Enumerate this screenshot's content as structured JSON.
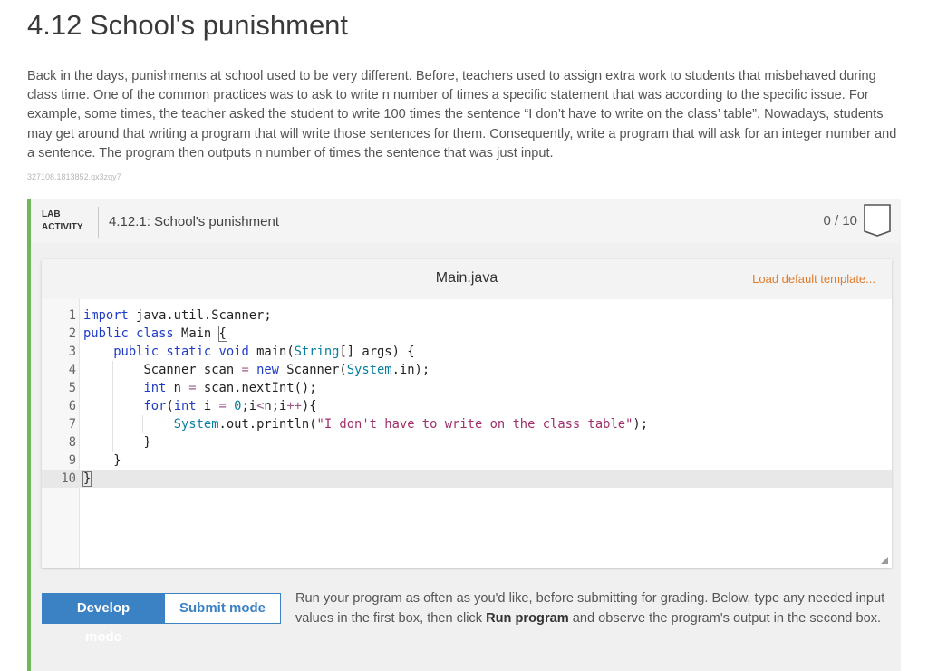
{
  "page": {
    "title": "4.12 School's punishment",
    "description": "Back in the days, punishments at school used to be very different. Before, teachers used to assign extra work to students that misbehaved during class time. One of the common practices was to ask to write n number of times a specific statement that was according to the specific issue. For example, some times, the teacher asked the student to write 100 times the sentence “I don’t have to write on the class’ table”. Nowadays, students may get around that writing a program that will write those sentences for them. Consequently, write a program that will ask for an integer number and a sentence. The program then outputs n number of times the sentence that was just input.",
    "hash": "327108.1813852.qx3zqy7"
  },
  "lab": {
    "tag_line1": "LAB",
    "tag_line2": "ACTIVITY",
    "name": "4.12.1: School's punishment",
    "score": "0 / 10",
    "accent_color": "#6fb85a"
  },
  "editor": {
    "filename": "Main.java",
    "load_template": "Load default template...",
    "line_numbers": [
      "1",
      "2",
      "3",
      "4",
      "5",
      "6",
      "7",
      "8",
      "9",
      "10"
    ],
    "code_lines": [
      "import java.util.Scanner;",
      "public class Main {",
      "    public static void main(String[] args) {",
      "        Scanner scan = new Scanner(System.in);",
      "        int n = scan.nextInt();",
      "        for(int i = 0;i<n;i++){",
      "            System.out.println(\"I don't have to write on the class table\");",
      "        }",
      "    }",
      "}"
    ]
  },
  "modes": {
    "develop": "Develop mode",
    "submit": "Submit mode",
    "active_color": "#3b82c4"
  },
  "instructions": {
    "part1": "Run your program as often as you'd like, before submitting for grading. Below, type any needed input values in the first box, then click ",
    "bold": "Run program",
    "part2": " and observe the program's output in the second box."
  }
}
